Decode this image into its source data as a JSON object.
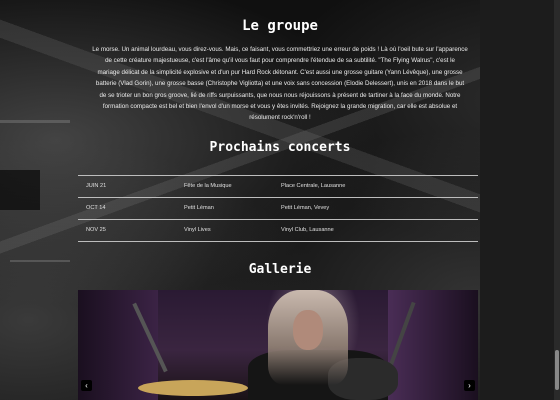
{
  "group": {
    "title": "Le groupe",
    "intro_lines": [
      "Le morse. Un animal lourdeau, vous direz-vous. Mais, ce faisant, vous commettriez une erreur de poids ! Là où l'oeil bute sur l'apparence",
      "de cette créature majestueuse, c'est l'âme qu'il vous faut pour comprendre l'étendue de sa subtilité. \"The Flying Walrus\", c'est le",
      "mariage délicat de la simplicité explosive et d'un pur Hard Rock détonant. C'est aussi une grosse guitare (Yann Lévêque), une grosse",
      "batterie (Vlad Gorin), une grosse basse (Christophe Vigliotta) et une voix sans concession (Elodie Delessert), unis en 2018 dans le but",
      "de se trioter un bon gros groove, lié de riffs surpuissants, que nous nous réjouissons à présent de tartiner à la face du monde. Notre",
      "formation compacte est bel et bien l'envol d'un morse et vous y êtes invités. Rejoignez la grande migration, car elle est absolue et",
      "résolument rock'n'roll !"
    ]
  },
  "concerts": {
    "title": "Prochains concerts",
    "rows": [
      {
        "date": "JUIN 21",
        "event": "Fête de la Musique",
        "place": "Place Centrale, Lausanne"
      },
      {
        "date": "OCT 14",
        "event": "Petit Léman",
        "place": "Petit Léman, Vevey"
      },
      {
        "date": "NOV 25",
        "event": "Vinyl Lives",
        "place": "Vinyl Club, Lausanne"
      }
    ]
  },
  "gallery": {
    "title": "Gallerie",
    "prev_icon": "‹",
    "next_icon": "›"
  },
  "icons": {
    "prev": "chevron-left-icon",
    "next": "chevron-right-icon"
  },
  "colors": {
    "background": "#0b0b0b",
    "text": "#f2f2f2",
    "divider": "#bdbdbd"
  }
}
